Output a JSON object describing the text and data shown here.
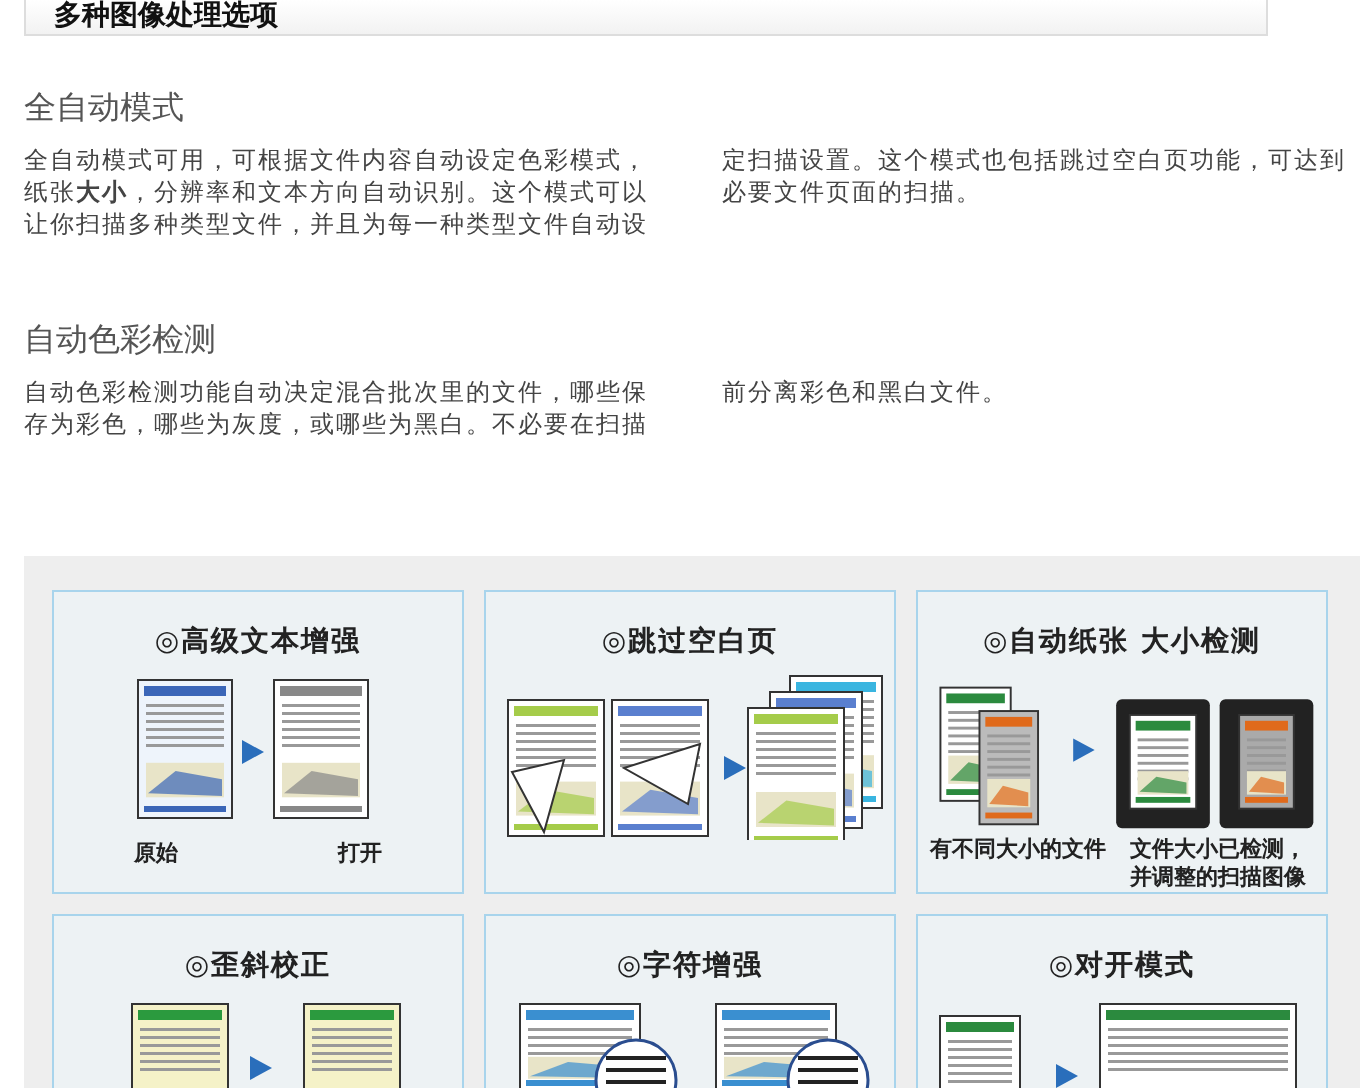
{
  "header": {
    "title": "多种图像处理选项"
  },
  "sections": [
    {
      "heading": "全自动模式",
      "columns": [
        "全自动模式可用，可根据文件内容自动设定色彩模式，纸张**大小**，分辨率和文本方向自动识别。这个模式可以让你扫描多种类型文件，并且为每一种类型文件自动设",
        "定扫描设置。这个模式也包括跳过空白页功能，可达到必要文件页面的扫描。"
      ]
    },
    {
      "heading": "自动色彩检测",
      "columns": [
        "自动色彩检测功能自动决定混合批次里的文件，哪些保存为彩色，哪些为灰度，或哪些为黑白。不必要在扫描",
        "前分离彩色和黑白文件。"
      ]
    }
  ],
  "features": [
    {
      "title": "◎高级文本增强",
      "captions": [
        "原始",
        "打开"
      ]
    },
    {
      "title": "◎跳过空白页"
    },
    {
      "title": "◎自动纸张 大小检测",
      "captions": [
        "有不同大小的文件",
        "文件大小已检测，并调整的扫描图像"
      ]
    },
    {
      "title": "◎歪斜校正"
    },
    {
      "title": "◎字符增强"
    },
    {
      "title": "◎对开模式"
    }
  ]
}
